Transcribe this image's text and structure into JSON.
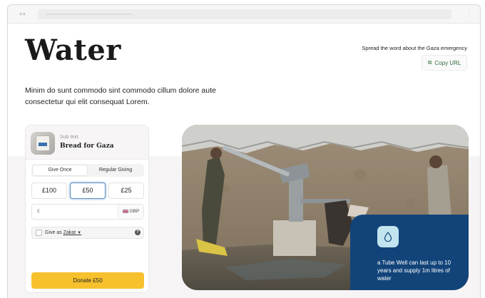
{
  "page": {
    "title": "Water",
    "description": "Minim do sunt commodo sint commodo cillum dolore aute consectetur qui elit consequat Lorem."
  },
  "share": {
    "text": "Spread the word about the Gaza emergency",
    "copy_label": "Copy URL"
  },
  "donation_card": {
    "sub_text": "Sub text",
    "campaign_name": "Bread for Gaza",
    "frequency_options": [
      "Give Once",
      "Regular Giving"
    ],
    "selected_frequency": "Give Once",
    "amounts": [
      "£100",
      "£50",
      "£25"
    ],
    "selected_amount": "£50",
    "currency_symbol": "£",
    "currency_code": "GBP",
    "flag_icon": "uk-flag-icon",
    "zakat_prefix": "Give as",
    "zakat_label": "Zakat",
    "donate_label": "Donate £50",
    "accent_color": "#f7c12d"
  },
  "hero": {
    "overlay_text": "a Tube Well can last up to 10 years and supply 1m litres of water",
    "overlay_color": "#12447a",
    "icon": "water-drop-icon"
  },
  "icons": {
    "nav": "arrows-icon",
    "more": "more-vertical-icon",
    "copy": "copy-icon",
    "info": "info-icon",
    "chevron": "chevron-down-icon"
  }
}
